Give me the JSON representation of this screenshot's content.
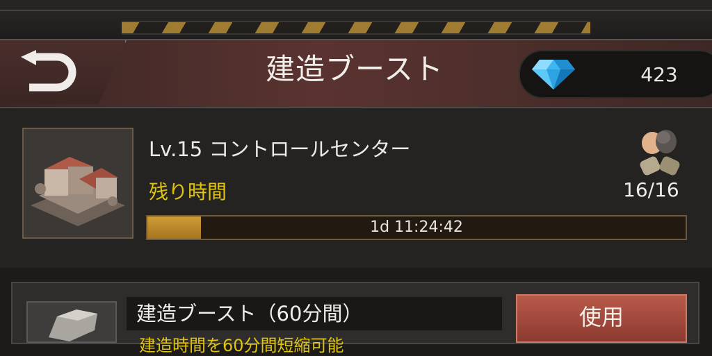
{
  "header": {
    "title": "建造ブースト",
    "back_icon": "back-arrow-icon",
    "currency": {
      "icon": "diamond-icon",
      "value": "423"
    }
  },
  "building": {
    "name": "Lv.15 コントロールセンター",
    "remaining_label": "残り時間",
    "help_icon": "alliance-help-icon",
    "help_count": "16/16",
    "timer": "1d 11:24:42",
    "progress": 0.1
  },
  "item": {
    "name": "建造ブースト（60分間）",
    "description": "建造時間を60分間短縮可能",
    "use_label": "使用"
  },
  "colors": {
    "accent": "#e0c410",
    "progress": "#cf9d37",
    "use_button": "#a54a3d"
  }
}
